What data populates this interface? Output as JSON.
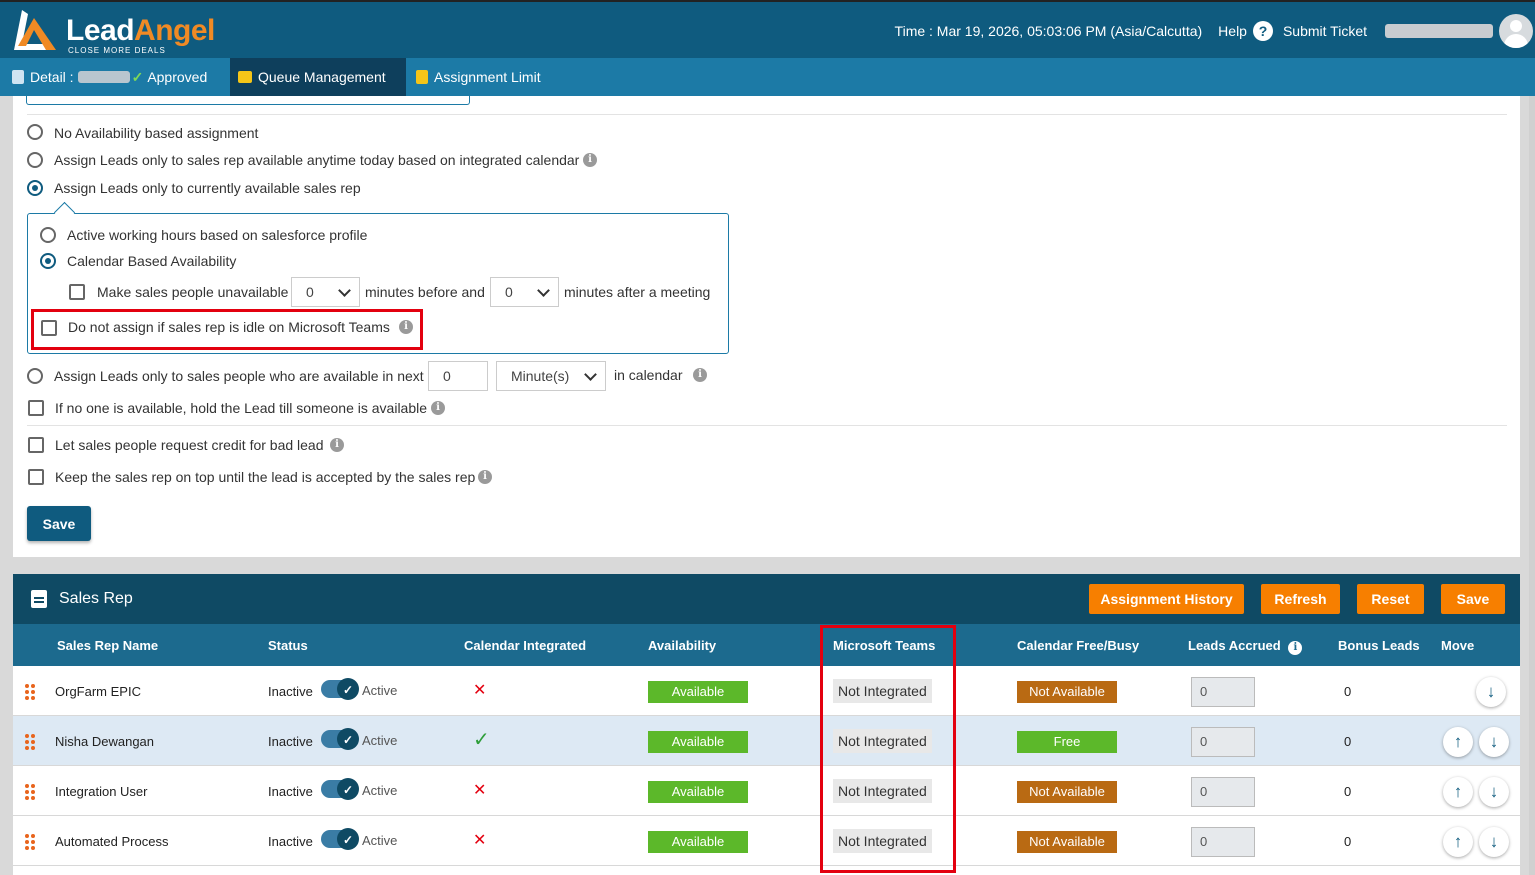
{
  "header": {
    "logo_lead": "Lead",
    "logo_angel": "Angel",
    "logo_tagline": "CLOSE MORE DEALS",
    "time": "Time : Mar 19, 2026, 05:03:06 PM (Asia/Calcutta)",
    "help": "Help",
    "submit_ticket": "Submit Ticket"
  },
  "tabs": [
    {
      "label": "Detail :",
      "status": "Approved"
    },
    {
      "label": "Queue Management"
    },
    {
      "label": "Assignment Limit"
    }
  ],
  "settings": {
    "opt_no_availability": "No Availability based assignment",
    "opt_anytime_today": "Assign Leads only to sales rep available anytime today based on integrated calendar",
    "opt_currently_available": "Assign Leads only to currently available sales rep",
    "sub_active_hours": "Active working hours based on salesforce profile",
    "sub_calendar": "Calendar Based Availability",
    "sub_make_unavailable": "Make sales people unavailable",
    "before_value": "0",
    "minutes_before": "minutes before and",
    "after_value": "0",
    "minutes_after": "minutes after a meeting",
    "teams_idle": "Do not assign if sales rep is idle on Microsoft Teams",
    "opt_next": "Assign Leads only to sales people who are available in next",
    "next_value": "0",
    "next_unit": "Minute(s)",
    "in_calendar": "in calendar",
    "hold_lead": "If no one is available, hold the Lead till someone is available",
    "bad_lead": "Let sales people request credit for bad lead",
    "keep_top": "Keep the sales rep on top until the lead is accepted by the sales rep",
    "save": "Save"
  },
  "sales_rep": {
    "title": "Sales Rep",
    "buttons": {
      "history": "Assignment History",
      "refresh": "Refresh",
      "reset": "Reset",
      "save": "Save"
    },
    "columns": [
      "Sales Rep Name",
      "Status",
      "Calendar Integrated",
      "Availability",
      "Microsoft Teams",
      "Calendar Free/Busy",
      "Leads Accrued",
      "Bonus Leads",
      "Move"
    ],
    "inactive_label": "Inactive",
    "active_label": "Active",
    "rows": [
      {
        "name": "OrgFarm EPIC",
        "calendar": "x",
        "availability": "Available",
        "teams": "Not Integrated",
        "freebusy": "Not Available",
        "accrued": "0",
        "bonus": "0"
      },
      {
        "name": "Nisha Dewangan",
        "calendar": "check",
        "availability": "Available",
        "teams": "Not Integrated",
        "freebusy": "Free",
        "accrued": "0",
        "bonus": "0"
      },
      {
        "name": "Integration User",
        "calendar": "x",
        "availability": "Available",
        "teams": "Not Integrated",
        "freebusy": "Not Available",
        "accrued": "0",
        "bonus": "0"
      },
      {
        "name": "Automated Process",
        "calendar": "x",
        "availability": "Available",
        "teams": "Not Integrated",
        "freebusy": "Not Available",
        "accrued": "0",
        "bonus": "0"
      }
    ]
  },
  "colors": {
    "header_bg": "#0f5b7f",
    "tab_bg": "#1c7aa6",
    "accent_orange": "#f77f00",
    "available_green": "#5cb82a",
    "not_available_brown": "#b96a13",
    "highlight_red": "#e3000f"
  }
}
